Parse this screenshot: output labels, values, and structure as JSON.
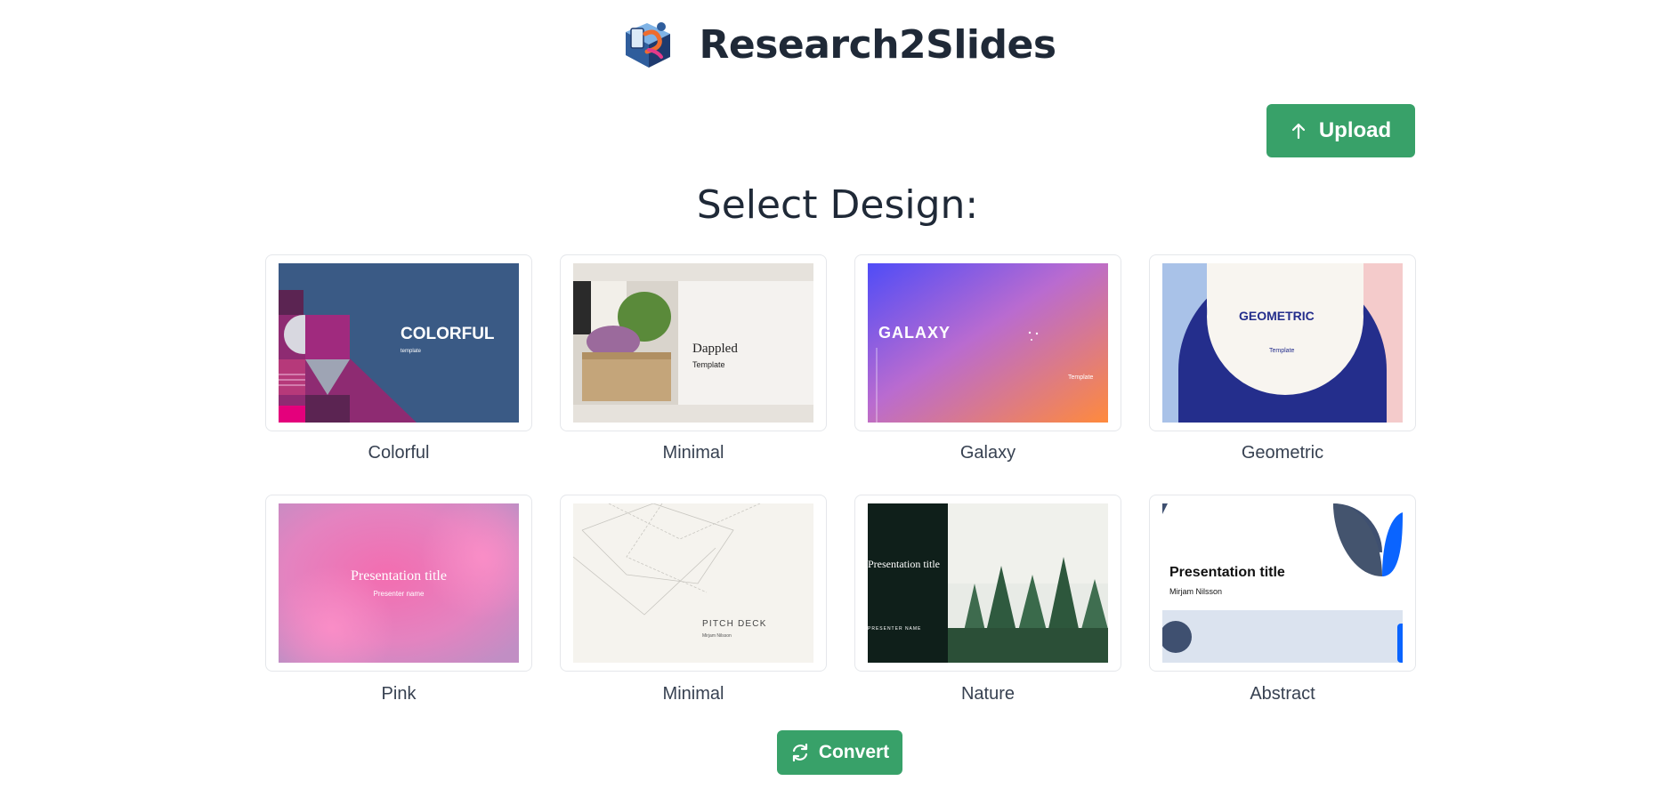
{
  "app": {
    "title": "Research2Slides",
    "logo_icon": "r2s-logo-icon"
  },
  "upload": {
    "label": "Upload",
    "icon": "arrow-up-icon"
  },
  "section": {
    "title": "Select Design:"
  },
  "designs": [
    {
      "name": "Colorful",
      "thumb_text": "COLORFUL",
      "thumb_sub": "template"
    },
    {
      "name": "Minimal",
      "thumb_text": "Dappled",
      "thumb_sub": "Template"
    },
    {
      "name": "Galaxy",
      "thumb_text": "GALAXY",
      "thumb_sub": "Template"
    },
    {
      "name": "Geometric",
      "thumb_text": "GEOMETRIC",
      "thumb_sub": "Template"
    },
    {
      "name": "Pink",
      "thumb_text": "Presentation title",
      "thumb_sub": "Presenter name"
    },
    {
      "name": "Minimal",
      "thumb_text": "PITCH DECK",
      "thumb_sub": "Mirjam Nilsson"
    },
    {
      "name": "Nature",
      "thumb_text": "Presentation title",
      "thumb_sub": "PRESENTER NAME"
    },
    {
      "name": "Abstract",
      "thumb_text": "Presentation title",
      "thumb_sub": "Mirjam Nilsson"
    }
  ],
  "convert": {
    "label": "Convert",
    "icon": "refresh-icon"
  },
  "colors": {
    "accent": "#38a169",
    "text": "#1f2937",
    "card_border": "#e5e7eb"
  }
}
